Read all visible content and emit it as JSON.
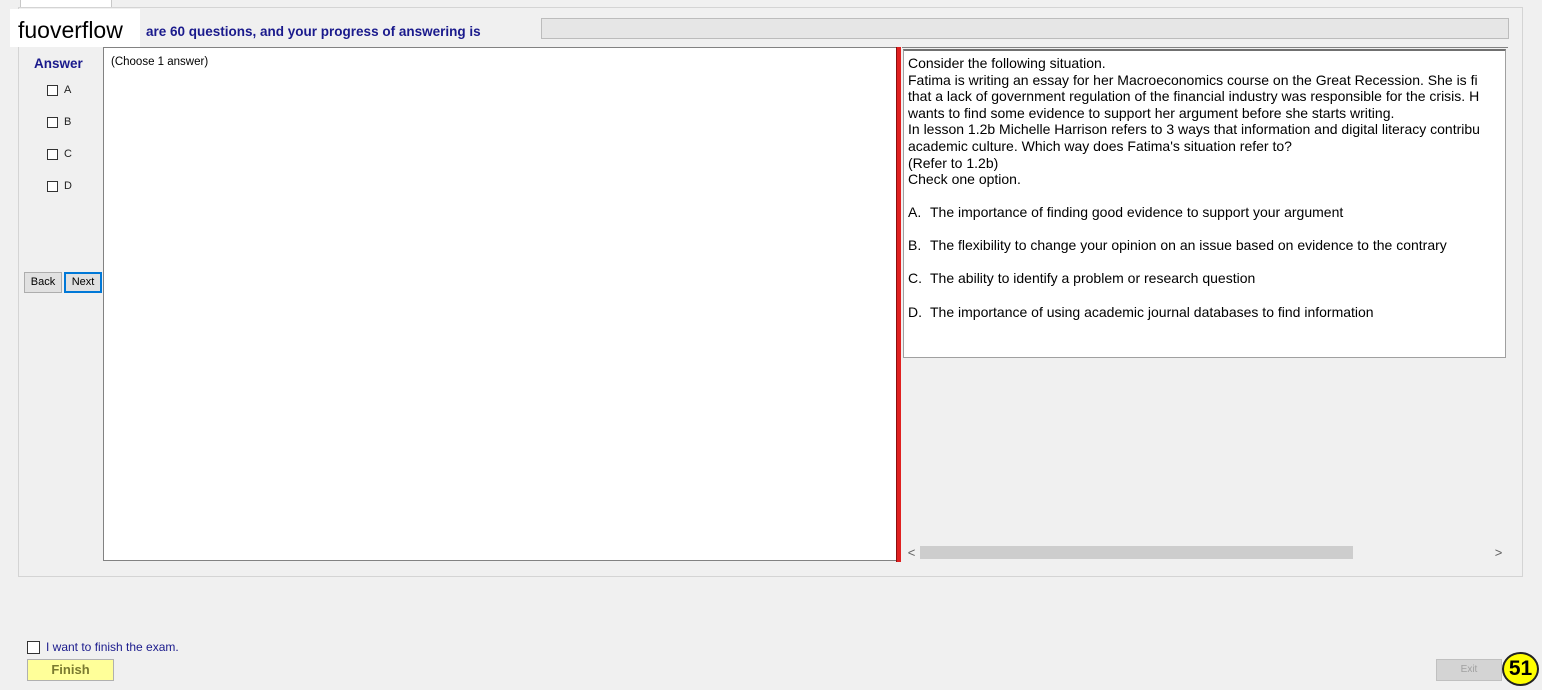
{
  "watermark": {
    "text": "fuoverflow"
  },
  "progress": {
    "text": "are 60 questions, and your progress of answering is",
    "value_percent": 0
  },
  "answer": {
    "heading": "Answer",
    "options": [
      "A",
      "B",
      "C",
      "D"
    ],
    "hint": "(Choose 1 answer)"
  },
  "nav": {
    "back_label": "Back",
    "next_label": "Next"
  },
  "question": {
    "lines": [
      "Consider the following situation.",
      "Fatima is writing an essay for her Macroeconomics course on the Great Recession. She is fi",
      "that a lack of government regulation of the financial industry was responsible for the crisis. H",
      "wants to find some evidence to support her argument before she starts writing.",
      "In lesson 1.2b Michelle Harrison refers to 3 ways that information and digital literacy contribu",
      "academic culture. Which way does Fatima's situation refer to?",
      "(Refer to 1.2b)",
      "Check one option."
    ],
    "choices": [
      {
        "letter": "A.",
        "text": "The importance of finding good evidence to support your argument"
      },
      {
        "letter": "B.",
        "text": "The flexibility to change your opinion on an issue based on evidence to the contrary"
      },
      {
        "letter": "C.",
        "text": "The ability to identify a problem or research question"
      },
      {
        "letter": "D.",
        "text": "The importance of using academic journal databases to find information"
      }
    ]
  },
  "scrollbar": {
    "left_arrow": "<",
    "right_arrow": ">"
  },
  "footer": {
    "finish_check_label": "I want to finish the exam.",
    "finish_label": "Finish",
    "exit_label": "Exit",
    "badge": "51"
  },
  "colors": {
    "accent_blue": "#1a1a8c",
    "divider_red": "#e02020",
    "finish_yellow": "#ffff99",
    "badge_yellow": "#ffff00"
  }
}
